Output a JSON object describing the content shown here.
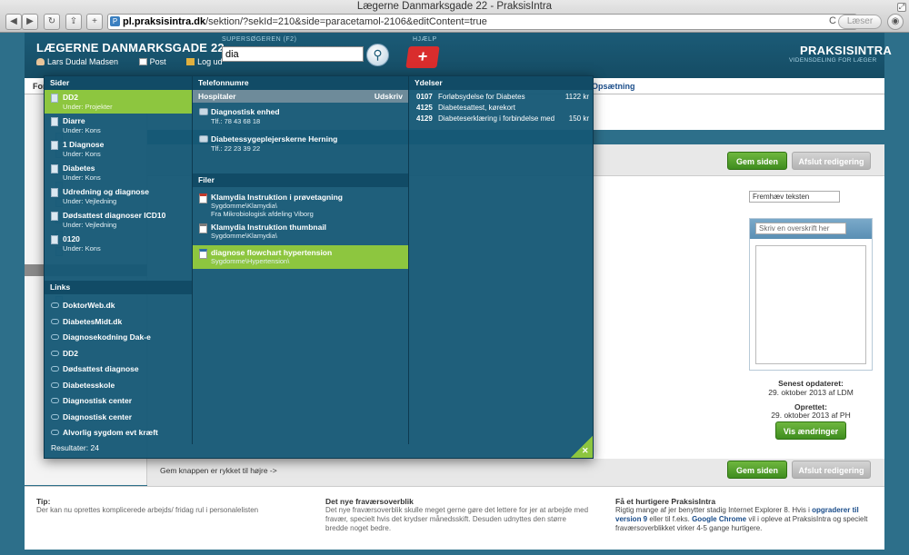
{
  "browser": {
    "window_title": "Lægerne Danmarksgade 22 - PraksisIntra",
    "url_domain": "pl.praksisintra.dk",
    "url_path": "/sektion/?sekId=210&side=paracetamol-2106&editContent=true",
    "reader_label": "Læser",
    "reload_glyph": "C"
  },
  "header": {
    "clinic_name": "LÆGERNE DANMARKSGADE 22",
    "user_name": "Lars Dudal Madsen",
    "post_label": "Post",
    "logout_label": "Log ud",
    "search_label": "SUPERSØGEREN (F2)",
    "search_value": "dia",
    "help_label": "HJÆLP",
    "brand": "PRAKSISINTRA",
    "brand_tagline": "VIDENSDELING FOR LÆGER"
  },
  "nav": {
    "first_fragment": "For",
    "last_item": "Opsætning"
  },
  "overlay": {
    "sider_head": "Sider",
    "sider": [
      {
        "title": "DD2",
        "sub": "Under: Projekter",
        "selected": true
      },
      {
        "title": "Diarre",
        "sub": "Under: Kons",
        "selected": false
      },
      {
        "title": "1 Diagnose",
        "sub": "Under: Kons",
        "selected": false
      },
      {
        "title": "Diabetes",
        "sub": "Under: Kons",
        "selected": false
      },
      {
        "title": "Udredning og diagnose",
        "sub": "Under: Vejledning",
        "selected": false
      },
      {
        "title": "Dødsattest diagnoser ICD10",
        "sub": "Under: Vejledning",
        "selected": false
      },
      {
        "title": "0120",
        "sub": "Under: Kons",
        "selected": false
      }
    ],
    "links_head": "Links",
    "links": [
      "DoktorWeb.dk",
      "DiabetesMidt.dk",
      "Diagnosekodning Dak-e",
      "DD2",
      "Dødsattest diagnose",
      "Diabetesskole",
      "Diagnostisk center",
      "Diagnostisk center",
      "Alvorlig sygdom evt kræft"
    ],
    "telefon_head": "Telefonnumre",
    "hospitaler_head": "Hospitaler",
    "udskriv": "Udskriv",
    "phones": [
      {
        "title": "Diagnostisk enhed",
        "sub": "Tlf.: 78 43 68 18"
      },
      {
        "title": "Diabetessygeplejerskerne Herning",
        "sub": "Tlf.: 22 23 39 22"
      }
    ],
    "filer_head": "Filer",
    "files": [
      {
        "title": "Klamydia Instruktion i prøvetagning",
        "sub1": "Sygdomme\\Klamydia\\",
        "sub2": "Fra Mikrobiologisk afdeling Viborg",
        "selected": false,
        "icon_color": "#c0392b"
      },
      {
        "title": "Klamydia Instruktion thumbnail",
        "sub1": "Sygdomme\\Klamydia\\",
        "sub2": "",
        "selected": false,
        "icon_color": "#7a7a7a"
      },
      {
        "title": "diagnose flowchart hypertension",
        "sub1": "Sygdomme\\Hypertension\\",
        "sub2": "",
        "selected": true,
        "icon_color": "#2e6da4"
      }
    ],
    "ydelser_head": "Ydelser",
    "ydelser": [
      {
        "code": "0107",
        "name": "Forløbsydelse for Diabetes",
        "price": "1122 kr"
      },
      {
        "code": "4125",
        "name": "Diabetesattest, kørekort",
        "price": ""
      },
      {
        "code": "4129",
        "name": "Diabeteserklæring i forbindelse med",
        "price": "150 kr"
      }
    ],
    "results": "Resultater: 24",
    "close_glyph": "✕"
  },
  "editor": {
    "save_label": "Gem siden",
    "finish_label": "Afslut redigering",
    "highlight_placeholder": "Fremhæv teksten",
    "heading_placeholder": "Skriv en overskrift her",
    "updated_label": "Senest opdateret:",
    "updated_value": "29. oktober 2013 af LDM",
    "created_label": "Oprettet:",
    "created_value": "29. oktober 2013 af PH",
    "changes_label": "Vis ændringer",
    "moved_hint": "Gem knappen er rykket til højre ->"
  },
  "footer": {
    "tip_title": "Tip:",
    "tip_text": "Der kan nu oprettes komplicerede arbejds/ fridag rul i personalelisten",
    "absence_title": "Det nye fraværsoverblik",
    "absence_text": "Det nye fraværsoverblik skulle meget gerne gøre det lettere for jer at arbejde med fravær, specielt hvis det krydser månedsskift. Desuden udnyttes den større bredde noget bedre.",
    "faster_title": "Få et hurtigere PraksisIntra",
    "faster_text_1": "Rigtig mange af jer benytter stadig Internet Explorer 8. Hvis i",
    "faster_link_1": "opgraderer til version 9",
    "faster_text_2": "eller til f.eks.",
    "faster_link_2": "Google Chrome",
    "faster_text_3": "vil i opleve at PraksisIntra og specielt fraværsoverblikket virker 4-5 gange hurtigere."
  },
  "colors": {
    "header_bg": "#1b5b77",
    "overlay_bg": "#165876",
    "selected_green": "#8dc63f",
    "button_green": "#4f9d2a",
    "help_red": "#d92d2d"
  }
}
